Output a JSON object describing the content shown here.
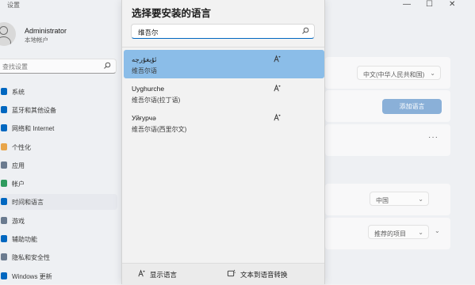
{
  "window": {
    "title": "设置",
    "controls": {
      "minimize": "—",
      "maximize": "☐",
      "close": "✕"
    }
  },
  "sidebar": {
    "user_name": "Administrator",
    "user_type": "本地帐户",
    "search_placeholder": "查找设置",
    "items": [
      {
        "label": "系统",
        "icon": "system-icon",
        "color": "#0067c0"
      },
      {
        "label": "蓝牙和其他设备",
        "icon": "bluetooth-icon",
        "color": "#0067c0"
      },
      {
        "label": "网络和 Internet",
        "icon": "network-icon",
        "color": "#0067c0"
      },
      {
        "label": "个性化",
        "icon": "personalization-icon",
        "color": "#e8a54a"
      },
      {
        "label": "应用",
        "icon": "apps-icon",
        "color": "#6b7b8f"
      },
      {
        "label": "帐户",
        "icon": "accounts-icon",
        "color": "#2e9b5e"
      },
      {
        "label": "时间和语言",
        "icon": "time-language-icon",
        "color": "#0067c0"
      },
      {
        "label": "游戏",
        "icon": "gaming-icon",
        "color": "#6b7b8f"
      },
      {
        "label": "辅助功能",
        "icon": "accessibility-icon",
        "color": "#0067c0"
      },
      {
        "label": "隐私和安全性",
        "icon": "privacy-icon",
        "color": "#6b7b8f"
      },
      {
        "label": "Windows 更新",
        "icon": "windows-update-icon",
        "color": "#0067c0"
      }
    ],
    "active_index": 6
  },
  "content": {
    "language_dropdown": "中文(中华人民共和国)",
    "add_language_button": "添加语言",
    "more": "···",
    "region_dropdown": "中国",
    "format_dropdown": "推荐的项目"
  },
  "dialog": {
    "title": "选择要安装的语言",
    "search_value": "维吾尔",
    "languages": [
      {
        "native": "ئۇيغۇرچە",
        "name": "维吾尔语",
        "selected": true
      },
      {
        "native": "Uyghurche",
        "name": "维吾尔语(拉丁语)",
        "selected": false
      },
      {
        "native": "Уйғурчә",
        "name": "维吾尔语(西里尔文)",
        "selected": false
      }
    ],
    "footer": {
      "display_language": "显示语言",
      "tts": "文本到语音转换"
    }
  }
}
